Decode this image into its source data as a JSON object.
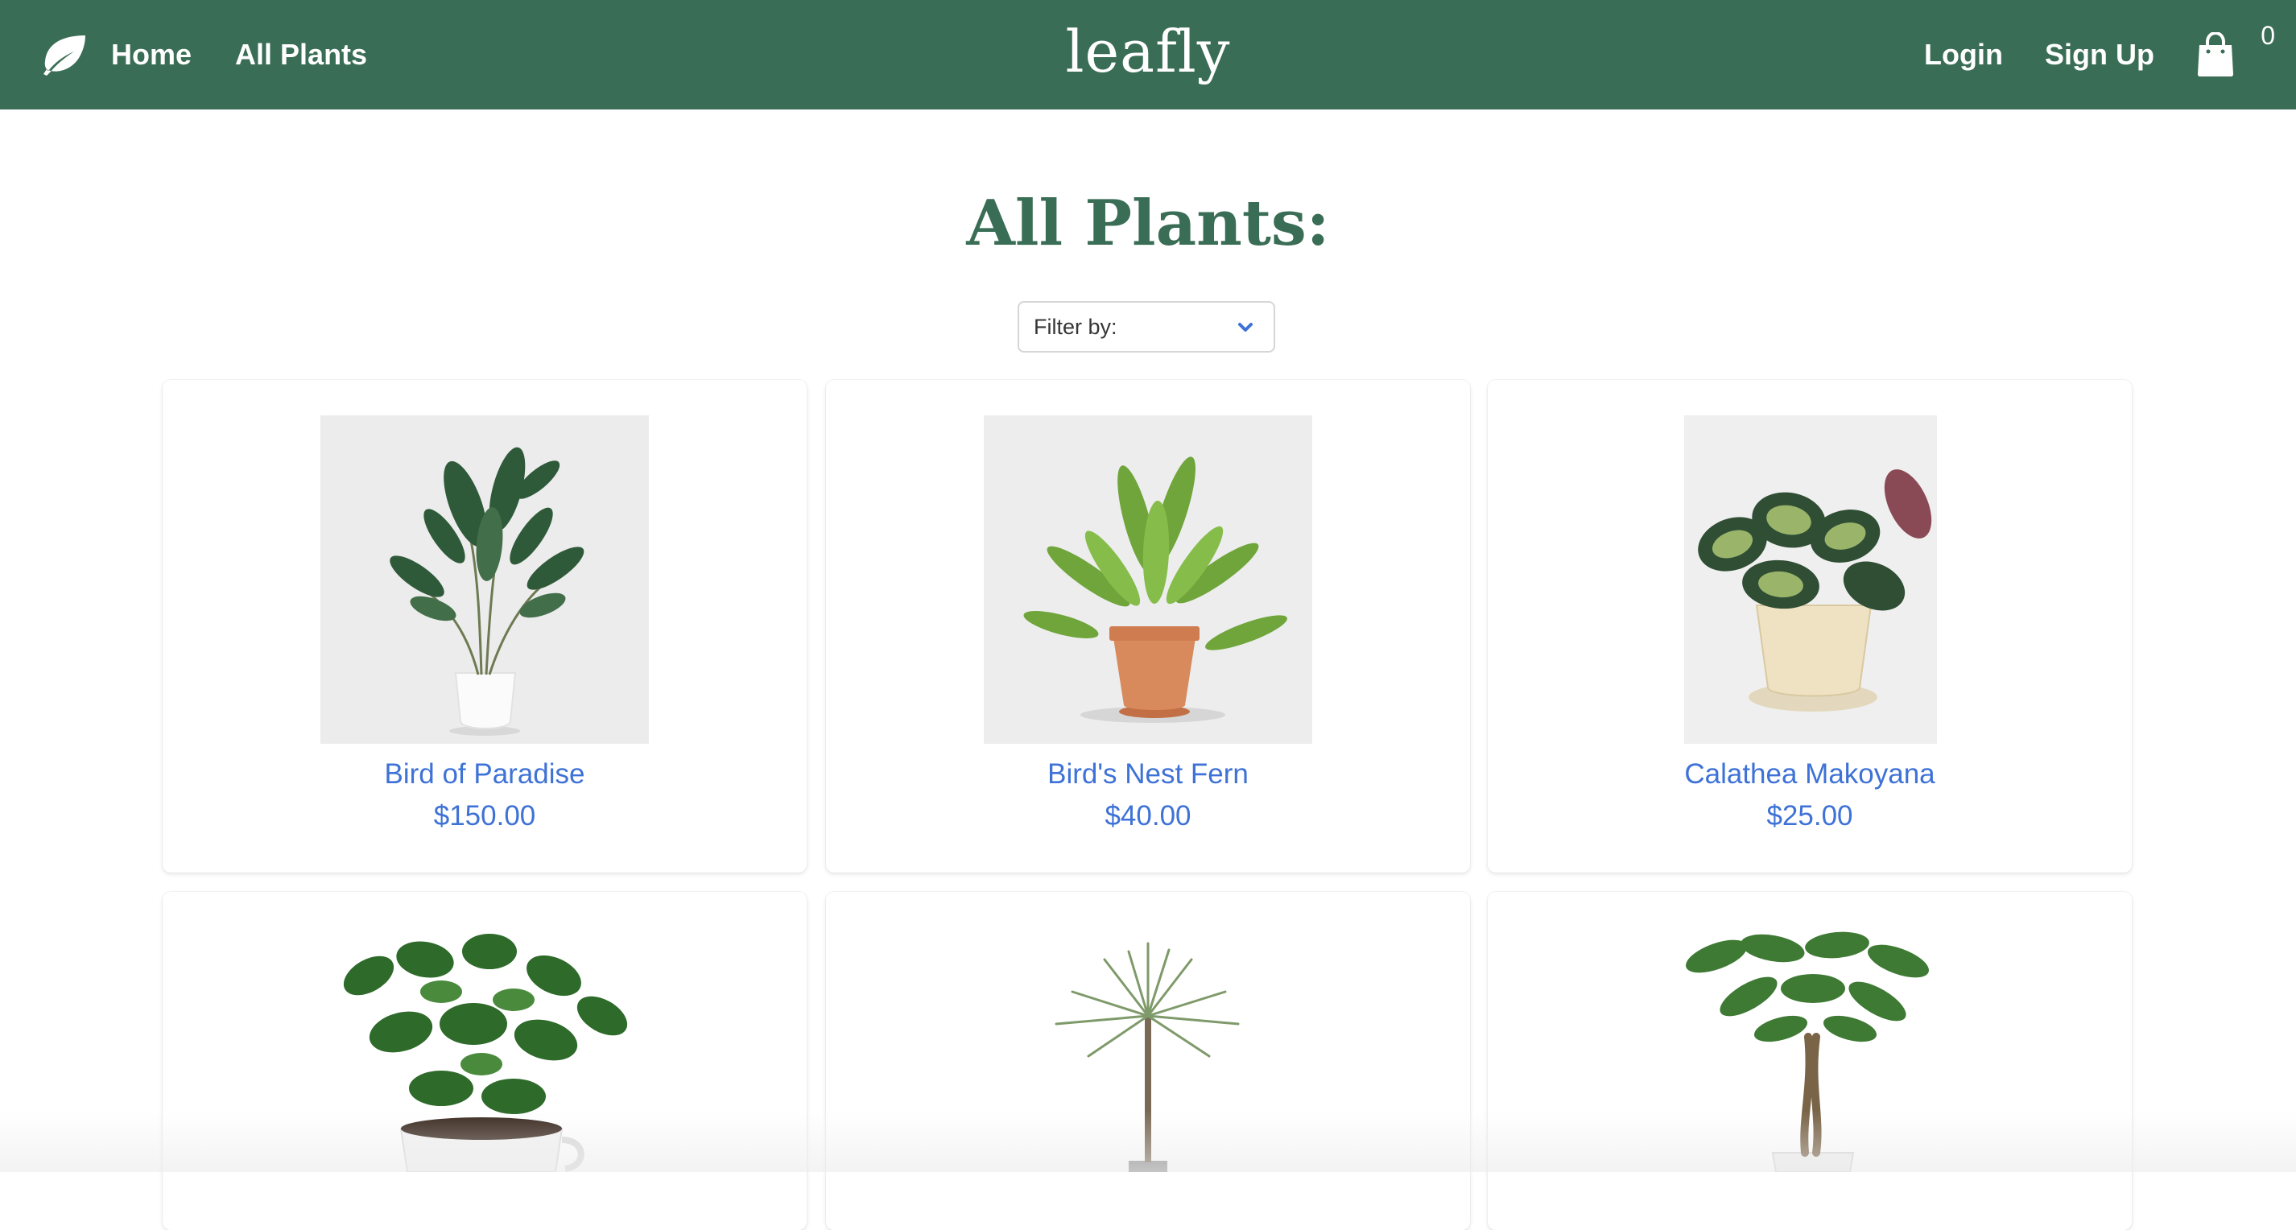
{
  "nav": {
    "home_label": "Home",
    "all_plants_label": "All Plants",
    "brand": "leafly",
    "login_label": "Login",
    "signup_label": "Sign Up",
    "cart_count": "0",
    "leaf_icon": "leaf-icon",
    "cart_icon": "shopping-bag-icon"
  },
  "page": {
    "title": "All Plants:",
    "filter_placeholder": "Filter by:"
  },
  "products": [
    {
      "name": "Bird of Paradise",
      "price": "$150.00"
    },
    {
      "name": "Bird's Nest Fern",
      "price": "$40.00"
    },
    {
      "name": "Calathea Makoyana",
      "price": "$25.00"
    }
  ],
  "colors": {
    "nav_bg": "#3a6d55",
    "title": "#3a6d55",
    "link": "#3e72d6"
  }
}
